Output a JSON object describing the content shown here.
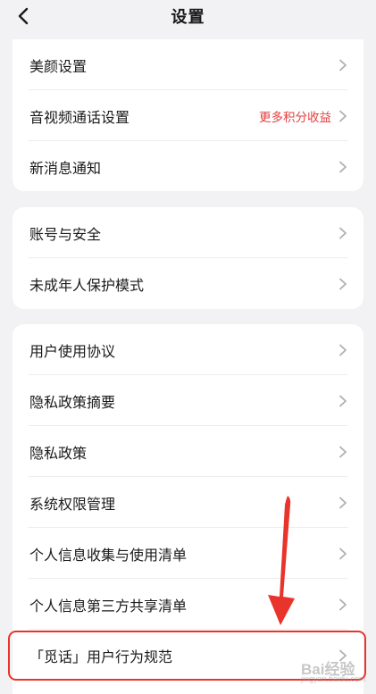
{
  "header": {
    "title": "设置",
    "back_icon": "chevron-left-icon"
  },
  "groups": [
    {
      "items": [
        {
          "label": "美颜设置",
          "extra": ""
        },
        {
          "label": "音视频通话设置",
          "extra": "更多积分收益"
        },
        {
          "label": "新消息通知",
          "extra": ""
        }
      ]
    },
    {
      "items": [
        {
          "label": "账号与安全",
          "extra": ""
        },
        {
          "label": "未成年人保护模式",
          "extra": ""
        }
      ]
    },
    {
      "items": [
        {
          "label": "用户使用协议",
          "extra": ""
        },
        {
          "label": "隐私政策摘要",
          "extra": ""
        },
        {
          "label": "隐私政策",
          "extra": ""
        },
        {
          "label": "系统权限管理",
          "extra": ""
        },
        {
          "label": "个人信息收集与使用清单",
          "extra": ""
        },
        {
          "label": "个人信息第三方共享清单",
          "extra": ""
        },
        {
          "label": "「觅话」用户行为规范",
          "extra": ""
        }
      ]
    }
  ],
  "annotation": {
    "arrow_icon": "red-arrow-icon",
    "highlight_color": "#e8342b"
  },
  "watermark": {
    "text": "Bai经验",
    "sub": "jingyan.baidu.com"
  },
  "colors": {
    "background": "#f2f2f4",
    "card": "#ffffff",
    "accent_red": "#e43d3d",
    "chevron": "#b0b0b5"
  }
}
